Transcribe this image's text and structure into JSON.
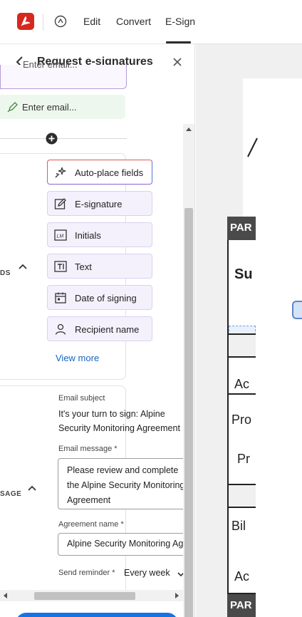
{
  "topbar": {
    "nav": [
      "Edit",
      "Convert",
      "E-Sign"
    ],
    "active_tab": "E-Sign"
  },
  "panel": {
    "title": "Request e-signatures",
    "recipients": [
      {
        "placeholder": "Enter email..."
      },
      {
        "placeholder": "Enter email..."
      }
    ],
    "fields_section_label": "DS",
    "fields": [
      {
        "label": "Auto-place fields",
        "icon": "sparkle-icon"
      },
      {
        "label": "E-signature",
        "icon": "signature-icon"
      },
      {
        "label": "Initials",
        "icon": "initials-icon"
      },
      {
        "label": "Text",
        "icon": "text-field-icon"
      },
      {
        "label": "Date of signing",
        "icon": "calendar-icon"
      },
      {
        "label": "Recipient name",
        "icon": "person-icon"
      }
    ],
    "view_more": "View more",
    "message_section_label": "SAGE",
    "email_subject_label": "Email subject",
    "email_subject_value": "It's your turn to sign: Alpine Security Monitoring Agreement",
    "email_message_label": "Email message",
    "required_mark": "*",
    "email_message_value": "Please review and complete the Alpine Security Monitoring Agreement",
    "agreement_name_label": "Agreement name",
    "agreement_name_value": "Alpine Security Monitoring Agreement",
    "send_reminder_label": "Send reminder",
    "send_reminder_value": "Every week"
  },
  "document": {
    "part_header_1": "PAR",
    "part_header_2": "PAR",
    "heading_fragment": "Su",
    "row_labels": [
      "Ac",
      "Pro",
      "Pr",
      "Bil",
      "Ac"
    ]
  },
  "colors": {
    "accent": "#1473e6",
    "acrobat_red": "#d7281e",
    "field_bg": "#f4f1fc"
  }
}
